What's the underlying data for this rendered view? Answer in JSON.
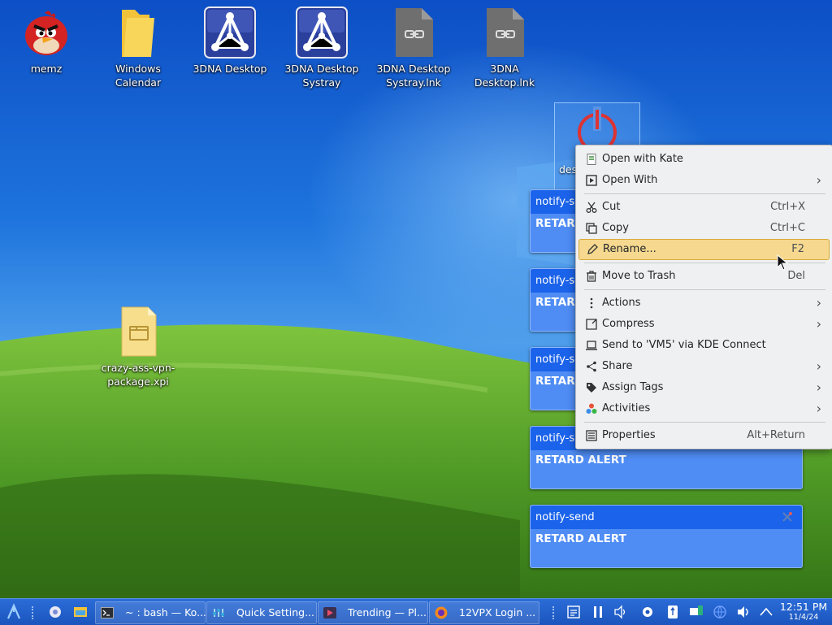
{
  "desktop": {
    "icons": [
      {
        "label": "memz",
        "icon": "angry-bird-icon"
      },
      {
        "label": "Windows Calendar",
        "icon": "folder-icon"
      },
      {
        "label": "3DNA Desktop",
        "icon": "3dna-app-icon"
      },
      {
        "label": "3DNA Desktop Systray",
        "icon": "3dna-app-icon"
      },
      {
        "label": "3DNA Desktop Systray.lnk",
        "icon": "link-file-icon"
      },
      {
        "label": "3DNA Desktop.lnk",
        "icon": "link-file-icon"
      },
      {
        "label": "crazy-ass-vpn-package.xpi",
        "icon": "archive-file-icon"
      }
    ],
    "selected_icon_label_fragment": "des"
  },
  "notifications": [
    {
      "app": "notify-se",
      "body": "RETARD"
    },
    {
      "app": "notify-se",
      "body": "RETARD"
    },
    {
      "app": "notify-se",
      "body": "RETARD"
    },
    {
      "app": "notify-se",
      "body": "RETARD ALERT"
    },
    {
      "app": "notify-send",
      "body": "RETARD ALERT"
    }
  ],
  "context_menu": {
    "items": [
      {
        "label": "Open with Kate",
        "icon": "kate-icon",
        "shortcut": "",
        "submenu": false
      },
      {
        "label": "Open With",
        "icon": "open-with-icon",
        "shortcut": "",
        "submenu": true
      },
      {
        "label": "Cut",
        "icon": "scissors-icon",
        "shortcut": "Ctrl+X",
        "submenu": false
      },
      {
        "label": "Copy",
        "icon": "copy-icon",
        "shortcut": "Ctrl+C",
        "submenu": false
      },
      {
        "label": "Rename...",
        "icon": "pencil-icon",
        "shortcut": "F2",
        "submenu": false,
        "highlighted": true
      },
      {
        "label": "Move to Trash",
        "icon": "trash-icon",
        "shortcut": "Del",
        "submenu": false
      },
      {
        "label": "Actions",
        "icon": "more-vertical-icon",
        "shortcut": "",
        "submenu": true
      },
      {
        "label": "Compress",
        "icon": "compress-icon",
        "shortcut": "",
        "submenu": true
      },
      {
        "label": "Send to 'VM5' via KDE Connect",
        "icon": "laptop-icon",
        "shortcut": "",
        "submenu": false
      },
      {
        "label": "Share",
        "icon": "share-icon",
        "shortcut": "",
        "submenu": true
      },
      {
        "label": "Assign Tags",
        "icon": "tag-icon",
        "shortcut": "",
        "submenu": true
      },
      {
        "label": "Activities",
        "icon": "activities-icon",
        "shortcut": "",
        "submenu": true
      },
      {
        "label": "Properties",
        "icon": "properties-icon",
        "shortcut": "Alt+Return",
        "submenu": false
      }
    ]
  },
  "taskbar": {
    "tasks": [
      {
        "label": "~ : bash — Ko...",
        "icon": "terminal-icon"
      },
      {
        "label": "Quick Setting...",
        "icon": "settings-icon"
      },
      {
        "label": "Trending — Pl...",
        "icon": "video-player-icon"
      },
      {
        "label": "12VPX Login ...",
        "icon": "firefox-icon"
      }
    ],
    "clock": {
      "time": "12:51 PM",
      "date": "11/4/24"
    }
  },
  "colors": {
    "taskbar": "#1b55bd",
    "notification_header": "#1b63ea",
    "notification_body": "#4f8df5",
    "menu_highlight": "#f6d98f",
    "menu_bg": "#eff0f1"
  }
}
